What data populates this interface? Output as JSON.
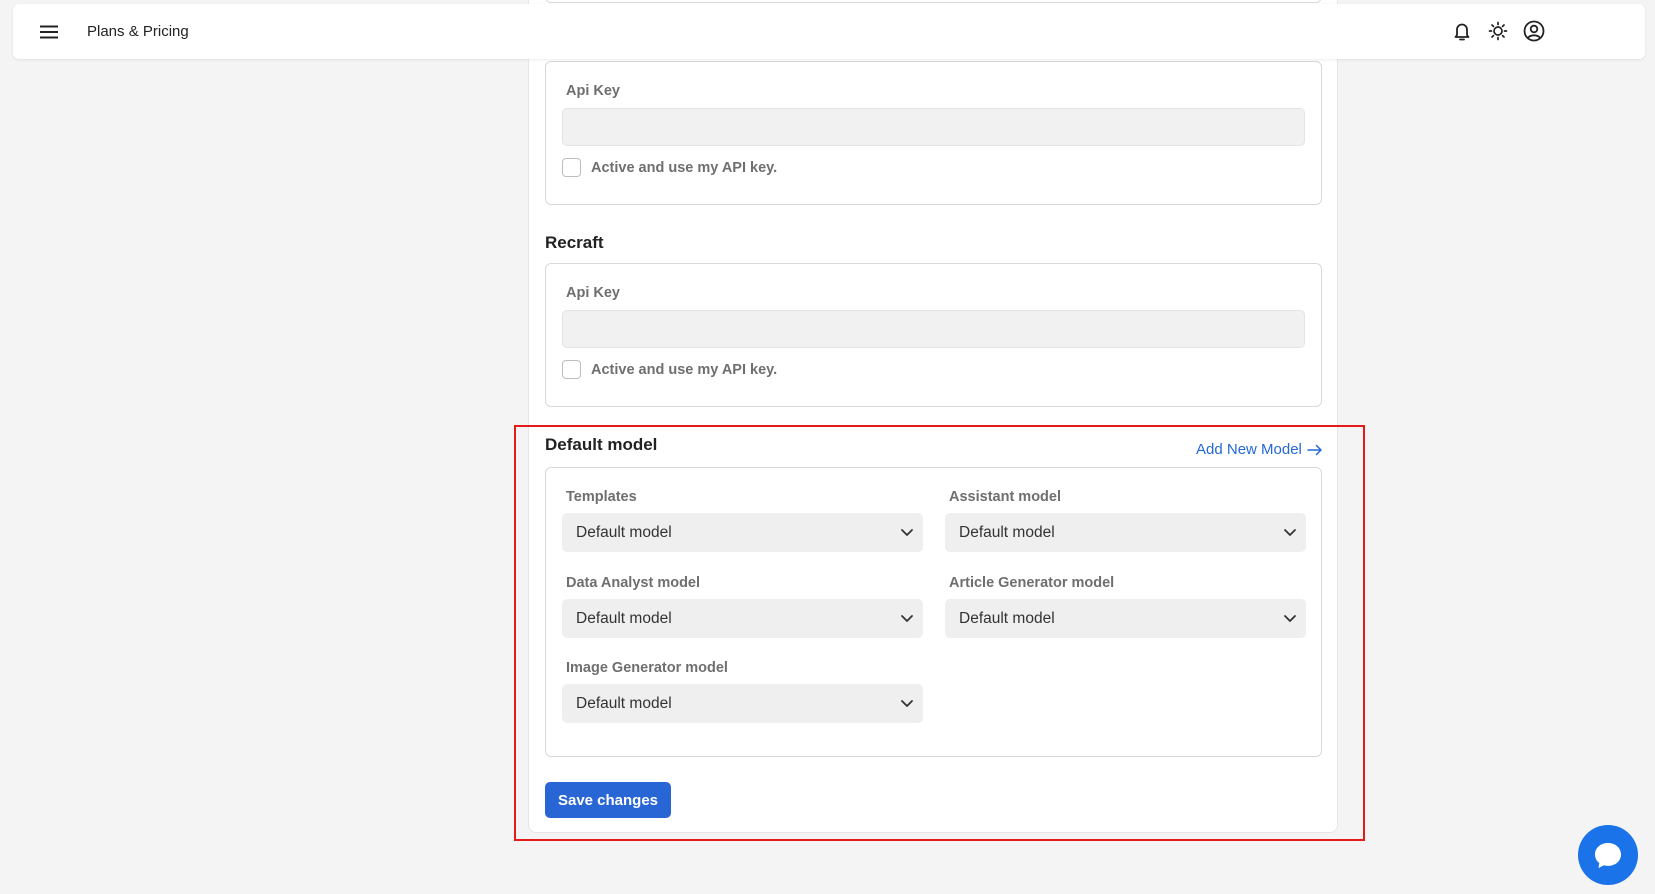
{
  "header": {
    "title": "Plans & Pricing",
    "icons": [
      "menu-icon",
      "bell-icon",
      "sun-icon",
      "user-circle-icon"
    ]
  },
  "api_sections": [
    {
      "heading": "",
      "api_key_label": "Api Key",
      "api_key_value": "",
      "checkbox_label": "Active and use my API key.",
      "checked": false
    },
    {
      "heading": "Recraft",
      "api_key_label": "Api Key",
      "api_key_value": "",
      "checkbox_label": "Active and use my API key.",
      "checked": false
    }
  ],
  "default_model": {
    "heading": "Default model",
    "add_link": "Add New Model",
    "fields": [
      {
        "label": "Templates",
        "value": "Default model"
      },
      {
        "label": "Assistant model",
        "value": "Default model"
      },
      {
        "label": "Data Analyst model",
        "value": "Default model"
      },
      {
        "label": "Article Generator model",
        "value": "Default model"
      },
      {
        "label": "Image Generator model",
        "value": "Default model"
      }
    ]
  },
  "actions": {
    "save_label": "Save changes"
  },
  "colors": {
    "accent": "#2866d6",
    "link": "#2469d8",
    "highlight": "#e41b1b",
    "chat": "#1a73e8"
  }
}
